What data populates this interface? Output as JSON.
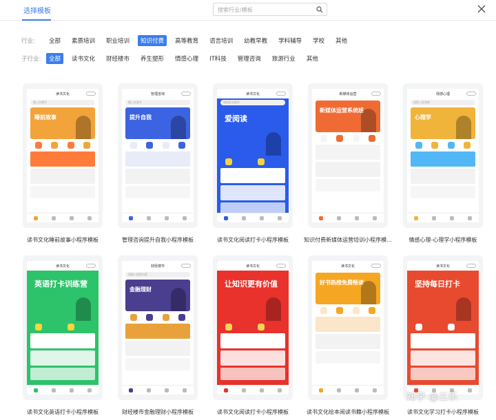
{
  "header": {
    "tab": "选择模板",
    "search_placeholder": "搜索行业/模板"
  },
  "industry": {
    "label": "行业:",
    "items": [
      "全部",
      "素质培训",
      "职业培训",
      "知识付费",
      "高等教育",
      "语言培训",
      "幼教早教",
      "学科辅导",
      "学校",
      "其他"
    ],
    "active": 3
  },
  "sub_industry": {
    "label": "子行业:",
    "items": [
      "全部",
      "读书文化",
      "财经楼市",
      "养生塑形",
      "情感心理",
      "IT科技",
      "管理咨询",
      "旅游行业",
      "其他"
    ],
    "active": 0
  },
  "templates": [
    {
      "title": "读书文化睡前故事小程序模板",
      "phone_title": "读书文化",
      "search": "输入关键字",
      "banner_text": "睡前故事",
      "theme": "#f2a33a",
      "accent": "#ff7b39",
      "bg": "#fff"
    },
    {
      "title": "管理咨询提升自我小程序模板",
      "phone_title": "管理咨询",
      "search": "输入关键字",
      "banner_text": "提升自我",
      "theme": "#3c63e2",
      "accent": "#e8ecf9",
      "bg": "#fff"
    },
    {
      "title": "读书文化阅读打卡小程序模板",
      "phone_title": "读书文化",
      "search": "请搜索关键字",
      "banner_text": "爱阅读",
      "theme": "#2a5bea",
      "accent": "#f6d33a",
      "bg": "#2a5bea"
    },
    {
      "title": "知识付费新媒体运营培训小程序模...",
      "phone_title": "新媒体运营",
      "search": "",
      "banner_text": "新媒体运营系统班",
      "theme": "#f06b33",
      "accent": "#f4f4f4",
      "bg": "#fff"
    },
    {
      "title": "情感心理-心理学小程序模板",
      "phone_title": "情感心理",
      "search": "搜索入驻课程",
      "banner_text": "心理学",
      "theme": "#f0b43a",
      "accent": "#52b7f5",
      "bg": "#fff"
    },
    {
      "title": "读书文化英语打卡小程序模板",
      "phone_title": "读书文化",
      "search": "",
      "banner_text": "英语打卡训练营",
      "theme": "#2cc36b",
      "accent": "#ffd43a",
      "bg": "#2cc36b"
    },
    {
      "title": "财经楼市金融理财小程序模板",
      "phone_title": "财经楼市",
      "search": "请输入搜索内容",
      "banner_text": "金融理财",
      "theme": "#4a3e8f",
      "accent": "#e9a23b",
      "bg": "#fff"
    },
    {
      "title": "读书文化阅读打卡小程序模板",
      "phone_title": "读书文化",
      "search": "",
      "banner_text": "让知识更有价值",
      "theme": "#e8322b",
      "accent": "#f7d55a",
      "bg": "#e8322b"
    },
    {
      "title": "读书文化绘本阅读书籍小程序模板",
      "phone_title": "读书文化",
      "search": "",
      "banner_text": "好书热榜免费畅读",
      "theme": "#f5a623",
      "accent": "#fbe6c9",
      "bg": "#fff"
    },
    {
      "title": "读书文化学习打卡小程序模板",
      "phone_title": "读书文化",
      "search": "",
      "banner_text": "坚持每日打卡",
      "theme": "#e84a2f",
      "accent": "#ffffff",
      "bg": "#e84a2f"
    }
  ],
  "watermark": "知乎 @三乐"
}
